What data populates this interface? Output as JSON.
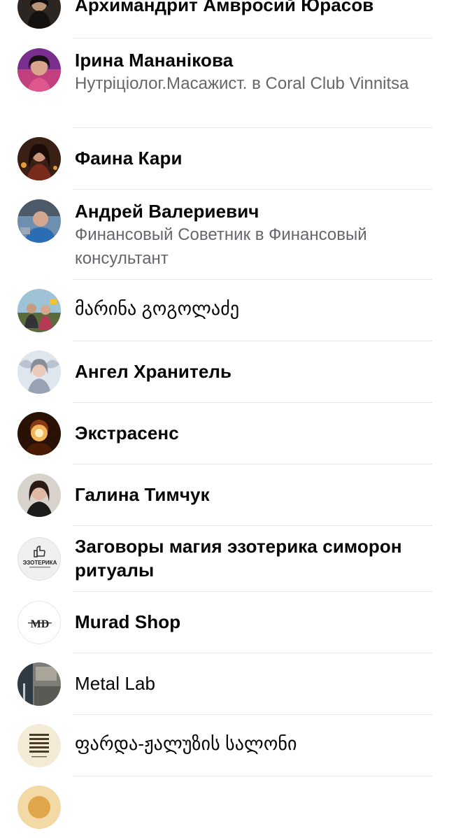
{
  "contacts": [
    {
      "name": "Архимандрит Амвросий  Юрасов",
      "subtitle": "",
      "avatar": "monk-portrait-avatar"
    },
    {
      "name": "Ірина Мананікова",
      "subtitle": "Нутріціолог.Масажист. в Coral Club Vinnitsa",
      "avatar": "woman-portrait-avatar"
    },
    {
      "name": "Фаина Кари",
      "subtitle": "",
      "avatar": "woman-dark-hair-avatar"
    },
    {
      "name": "Андрей Валериевич",
      "subtitle": "Финансовый Советник в Финансовый консультант",
      "avatar": "man-portrait-avatar"
    },
    {
      "name": "მარინა გოგოლაძე",
      "subtitle": "",
      "avatar": "group-photo-avatar"
    },
    {
      "name": "Ангел Хранитель",
      "subtitle": "",
      "avatar": "angel-image-avatar"
    },
    {
      "name": "Экстрасенс",
      "subtitle": "",
      "avatar": "crystal-ball-avatar"
    },
    {
      "name": "Галина Тимчук",
      "subtitle": "",
      "avatar": "woman-portrait-avatar"
    },
    {
      "name": "Заговоры магия эзотерика симорон ритуалы",
      "subtitle": "",
      "avatar": "ezoterika-logo-avatar",
      "logo_text": "ЭЗОТЕРИКА"
    },
    {
      "name": "Murad Shop",
      "subtitle": "",
      "avatar": "md-logo-avatar",
      "logo_text": "MD"
    },
    {
      "name": "Metal Lab",
      "subtitle": "",
      "avatar": "interior-photo-avatar"
    },
    {
      "name": "ფარდა-ჟალუზის სალონი",
      "subtitle": "",
      "avatar": "blinds-logo-avatar"
    }
  ]
}
